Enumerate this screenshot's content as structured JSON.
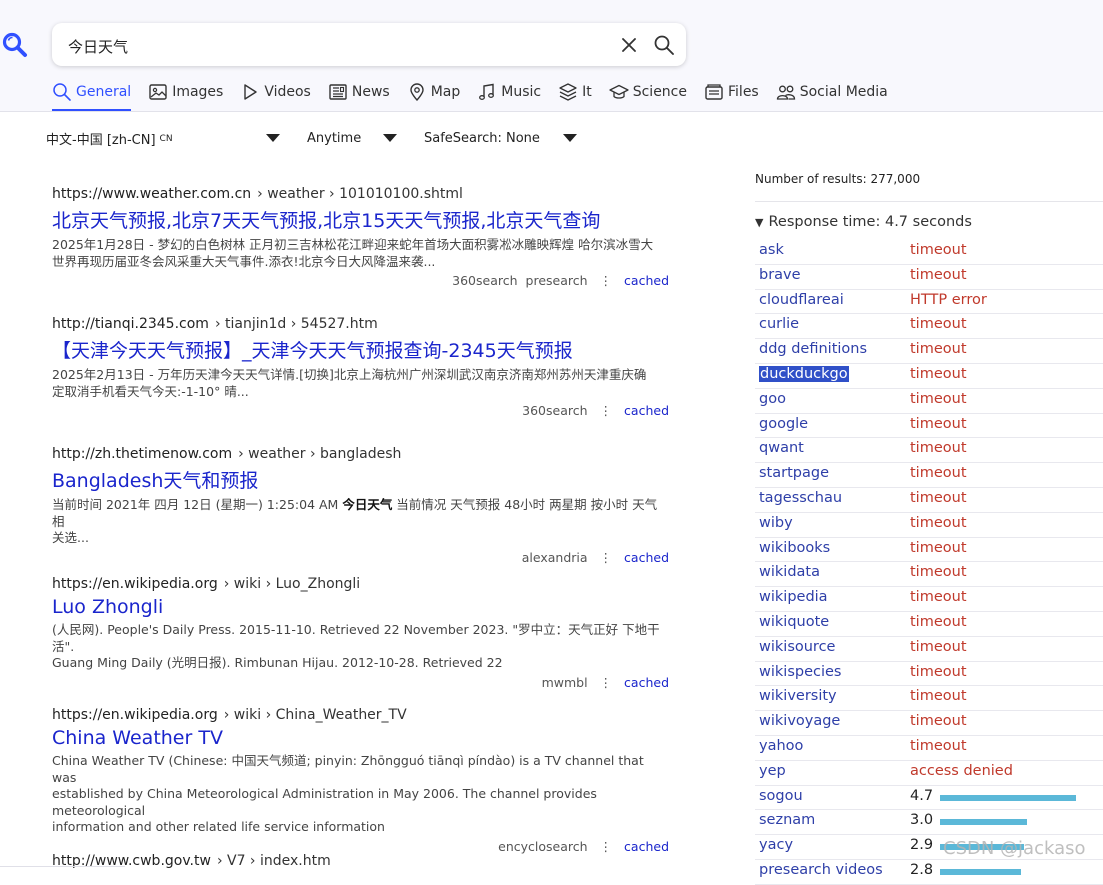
{
  "search": {
    "query": "今日天气"
  },
  "tabs": [
    {
      "label": "General",
      "icon": "search-icon",
      "active": true
    },
    {
      "label": "Images",
      "icon": "image-icon"
    },
    {
      "label": "Videos",
      "icon": "play-icon"
    },
    {
      "label": "News",
      "icon": "newspaper-icon"
    },
    {
      "label": "Map",
      "icon": "map-pin-icon"
    },
    {
      "label": "Music",
      "icon": "music-note-icon"
    },
    {
      "label": "It",
      "icon": "layers-icon"
    },
    {
      "label": "Science",
      "icon": "graduation-cap-icon"
    },
    {
      "label": "Files",
      "icon": "files-icon"
    },
    {
      "label": "Social Media",
      "icon": "people-icon"
    }
  ],
  "filters": {
    "language": "中文-中国 [zh-CN]",
    "language_code": "CN",
    "time": "Anytime",
    "safesearch": "SafeSearch: None"
  },
  "results": [
    {
      "url": "https://www.weather.com.cn",
      "path": "› weather › 101010100.shtml",
      "title": "北京天气预报,北京7天天气预报,北京15天天气预报,北京天气查询",
      "snippet_lines": [
        "2025年1月28日 - 梦幻的白色树林 正月初三吉林松花江畔迎来蛇年首场大面积雾凇冰雕映辉煌 哈尔滨冰雪大",
        "世界再现历届亚冬会风采重大天气事件.添衣!北京今日大风降温来袭..."
      ],
      "engines": [
        "360search",
        "presearch"
      ],
      "cached": "cached"
    },
    {
      "url": "http://tianqi.2345.com",
      "path": "› tianjin1d › 54527.htm",
      "title": "【天津今天天气预报】_天津今天天气预报查询-2345天气预报",
      "snippet_lines": [
        "2025年2月13日 - 万年历天津今天天气详情.[切换]北京上海杭州广州深圳武汉南京济南郑州苏州天津重庆确",
        "定取消手机看天气今天:-1-10° 晴..."
      ],
      "engines": [
        "360search"
      ],
      "cached": "cached"
    },
    {
      "url": "http://zh.thetimenow.com",
      "path": "› weather › bangladesh",
      "title": "Bangladesh天气和预报",
      "snippet_before": "当前时间 2021年 四月 12日 (星期一) 1:25:04 AM ",
      "snippet_bold": "今日天气",
      "snippet_after": " 当前情况 天气预报 48小时 两星期 按小时 天气相",
      "snippet_line2": "关选...",
      "engines": [
        "alexandria"
      ],
      "cached": "cached"
    },
    {
      "url": "https://en.wikipedia.org",
      "path": "› wiki › Luo_Zhongli",
      "title": "Luo Zhongli",
      "snippet_lines": [
        "(人民网). People's Daily Press. 2015-11-10. Retrieved 22 November 2023. \"罗中立：天气正好 下地干活\".",
        "Guang Ming Daily (光明日报). Rimbunan Hijau. 2012-10-28. Retrieved 22"
      ],
      "engines": [
        "mwmbl"
      ],
      "cached": "cached"
    },
    {
      "url": "https://en.wikipedia.org",
      "path": "› wiki › China_Weather_TV",
      "title": "China Weather TV",
      "snippet_lines": [
        "China Weather TV (Chinese: 中国天气频道; pinyin: Zhōngguó tiānqì píndào) is a TV channel that was",
        "established by China Meteorological Administration in May 2006. The channel provides meteorological",
        "information and other related life service information"
      ],
      "engines": [
        "encyclosearch"
      ],
      "cached": "cached"
    },
    {
      "url": "http://www.cwb.gov.tw",
      "path": "› V7 › index.htm",
      "title": "",
      "snippet_lines": [],
      "engines": [],
      "cached": ""
    }
  ],
  "sidebar": {
    "number_of_results": "Number of results: 277,000",
    "response_time": "Response time: 4.7 seconds",
    "engines": [
      {
        "name": "ask",
        "status": "timeout"
      },
      {
        "name": "brave",
        "status": "timeout"
      },
      {
        "name": "cloudflareai",
        "status": "HTTP error"
      },
      {
        "name": "curlie",
        "status": "timeout"
      },
      {
        "name": "ddg definitions",
        "status": "timeout"
      },
      {
        "name": "duckduckgo",
        "status": "timeout",
        "selected": true
      },
      {
        "name": "goo",
        "status": "timeout"
      },
      {
        "name": "google",
        "status": "timeout"
      },
      {
        "name": "qwant",
        "status": "timeout"
      },
      {
        "name": "startpage",
        "status": "timeout"
      },
      {
        "name": "tagesschau",
        "status": "timeout"
      },
      {
        "name": "wiby",
        "status": "timeout"
      },
      {
        "name": "wikibooks",
        "status": "timeout"
      },
      {
        "name": "wikidata",
        "status": "timeout"
      },
      {
        "name": "wikipedia",
        "status": "timeout"
      },
      {
        "name": "wikiquote",
        "status": "timeout"
      },
      {
        "name": "wikisource",
        "status": "timeout"
      },
      {
        "name": "wikispecies",
        "status": "timeout"
      },
      {
        "name": "wikiversity",
        "status": "timeout"
      },
      {
        "name": "wikivoyage",
        "status": "timeout"
      },
      {
        "name": "yahoo",
        "status": "timeout"
      },
      {
        "name": "yep",
        "status": "access denied"
      },
      {
        "name": "sogou",
        "time": "4.7",
        "time_value": 4.7
      },
      {
        "name": "seznam",
        "time": "3.0",
        "time_value": 3.0
      },
      {
        "name": "yacy",
        "time": "2.9",
        "time_value": 2.9
      },
      {
        "name": "presearch videos",
        "time": "2.8",
        "time_value": 2.8
      }
    ]
  },
  "watermark": "CSDN @jackaso",
  "colors": {
    "accent": "#3050ff",
    "link": "#1a25cc",
    "error": "#c0392b",
    "bar": "#5bb8d8"
  }
}
